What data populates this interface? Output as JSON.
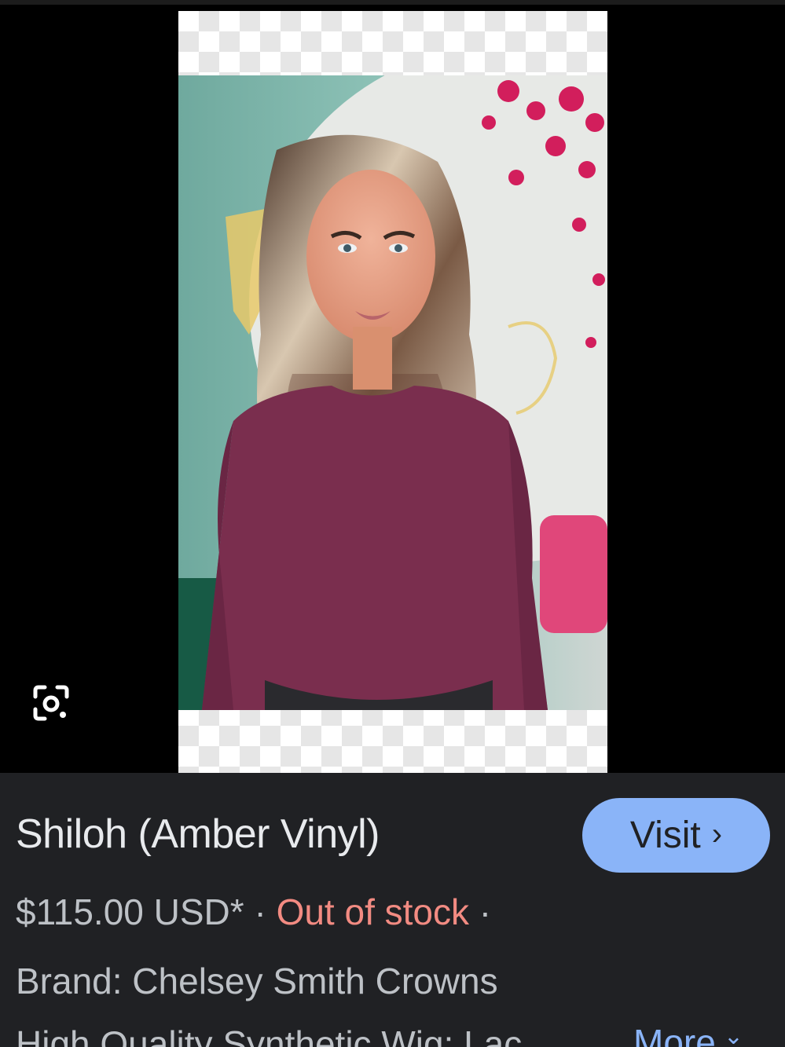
{
  "viewer": {
    "lens_icon": "google-lens-icon",
    "image_alt": "Woman wearing a wavy highlighted wig and a plum long-sleeve top"
  },
  "product": {
    "title": "Shiloh (Amber Vinyl)",
    "price": "$115.00 USD*",
    "separator": " · ",
    "stock_status": "Out of stock",
    "trailing_separator": " ·",
    "brand": "Brand: Chelsey Smith Crowns",
    "description_snippet": "High Quality Synthetic Wig; Lac"
  },
  "actions": {
    "visit_label": "Visit",
    "visit_chevron": "›",
    "more_label": "More",
    "more_chevron": "⌄"
  },
  "colors": {
    "panel_bg": "#202124",
    "visit_button": "#8ab4f8",
    "out_of_stock": "#f28b82",
    "link": "#8ab4f8"
  }
}
